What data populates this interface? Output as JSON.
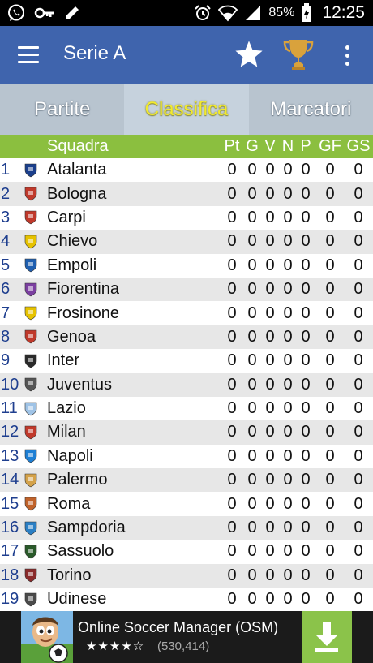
{
  "status_bar": {
    "battery_percent": "85%",
    "time": "12:25",
    "icons_left": [
      "whatsapp-icon",
      "key-icon",
      "pencil-icon"
    ],
    "icons_right": [
      "alarm-icon",
      "wifi-icon",
      "signal-icon",
      "battery-icon"
    ]
  },
  "app_bar": {
    "title": "Serie A",
    "icons": [
      "menu-icon",
      "star-icon",
      "trophy-icon",
      "more-vert-icon"
    ],
    "colors": {
      "background": "#3f64ad",
      "trophy": "#d9a23c"
    }
  },
  "tabs": [
    {
      "label": "Partite",
      "active": false
    },
    {
      "label": "Classifica",
      "active": true
    },
    {
      "label": "Marcatori",
      "active": false
    }
  ],
  "table": {
    "header": {
      "team": "Squadra",
      "pt": "Pt",
      "g": "G",
      "v": "V",
      "n": "N",
      "p": "P",
      "gf": "GF",
      "gs": "GS"
    },
    "header_color": "#8bbf3f",
    "rows": [
      {
        "pos": "1",
        "team": "Atalanta",
        "pt": "0",
        "g": "0",
        "v": "0",
        "n": "0",
        "p": "0",
        "gf": "0",
        "gs": "0"
      },
      {
        "pos": "2",
        "team": "Bologna",
        "pt": "0",
        "g": "0",
        "v": "0",
        "n": "0",
        "p": "0",
        "gf": "0",
        "gs": "0"
      },
      {
        "pos": "3",
        "team": "Carpi",
        "pt": "0",
        "g": "0",
        "v": "0",
        "n": "0",
        "p": "0",
        "gf": "0",
        "gs": "0"
      },
      {
        "pos": "4",
        "team": "Chievo",
        "pt": "0",
        "g": "0",
        "v": "0",
        "n": "0",
        "p": "0",
        "gf": "0",
        "gs": "0"
      },
      {
        "pos": "5",
        "team": "Empoli",
        "pt": "0",
        "g": "0",
        "v": "0",
        "n": "0",
        "p": "0",
        "gf": "0",
        "gs": "0"
      },
      {
        "pos": "6",
        "team": "Fiorentina",
        "pt": "0",
        "g": "0",
        "v": "0",
        "n": "0",
        "p": "0",
        "gf": "0",
        "gs": "0"
      },
      {
        "pos": "7",
        "team": "Frosinone",
        "pt": "0",
        "g": "0",
        "v": "0",
        "n": "0",
        "p": "0",
        "gf": "0",
        "gs": "0"
      },
      {
        "pos": "8",
        "team": "Genoa",
        "pt": "0",
        "g": "0",
        "v": "0",
        "n": "0",
        "p": "0",
        "gf": "0",
        "gs": "0"
      },
      {
        "pos": "9",
        "team": "Inter",
        "pt": "0",
        "g": "0",
        "v": "0",
        "n": "0",
        "p": "0",
        "gf": "0",
        "gs": "0"
      },
      {
        "pos": "10",
        "team": "Juventus",
        "pt": "0",
        "g": "0",
        "v": "0",
        "n": "0",
        "p": "0",
        "gf": "0",
        "gs": "0"
      },
      {
        "pos": "11",
        "team": "Lazio",
        "pt": "0",
        "g": "0",
        "v": "0",
        "n": "0",
        "p": "0",
        "gf": "0",
        "gs": "0"
      },
      {
        "pos": "12",
        "team": "Milan",
        "pt": "0",
        "g": "0",
        "v": "0",
        "n": "0",
        "p": "0",
        "gf": "0",
        "gs": "0"
      },
      {
        "pos": "13",
        "team": "Napoli",
        "pt": "0",
        "g": "0",
        "v": "0",
        "n": "0",
        "p": "0",
        "gf": "0",
        "gs": "0"
      },
      {
        "pos": "14",
        "team": "Palermo",
        "pt": "0",
        "g": "0",
        "v": "0",
        "n": "0",
        "p": "0",
        "gf": "0",
        "gs": "0"
      },
      {
        "pos": "15",
        "team": "Roma",
        "pt": "0",
        "g": "0",
        "v": "0",
        "n": "0",
        "p": "0",
        "gf": "0",
        "gs": "0"
      },
      {
        "pos": "16",
        "team": "Sampdoria",
        "pt": "0",
        "g": "0",
        "v": "0",
        "n": "0",
        "p": "0",
        "gf": "0",
        "gs": "0"
      },
      {
        "pos": "17",
        "team": "Sassuolo",
        "pt": "0",
        "g": "0",
        "v": "0",
        "n": "0",
        "p": "0",
        "gf": "0",
        "gs": "0"
      },
      {
        "pos": "18",
        "team": "Torino",
        "pt": "0",
        "g": "0",
        "v": "0",
        "n": "0",
        "p": "0",
        "gf": "0",
        "gs": "0"
      },
      {
        "pos": "19",
        "team": "Udinese",
        "pt": "0",
        "g": "0",
        "v": "0",
        "n": "0",
        "p": "0",
        "gf": "0",
        "gs": "0"
      }
    ]
  },
  "ad": {
    "title": "Online Soccer Manager (OSM)",
    "stars": "★★★★☆",
    "rating_stars": 4.5,
    "review_count": "(530,414)",
    "icons": [
      "osm-app-icon",
      "download-icon"
    ],
    "download_color": "#8bc34a"
  }
}
